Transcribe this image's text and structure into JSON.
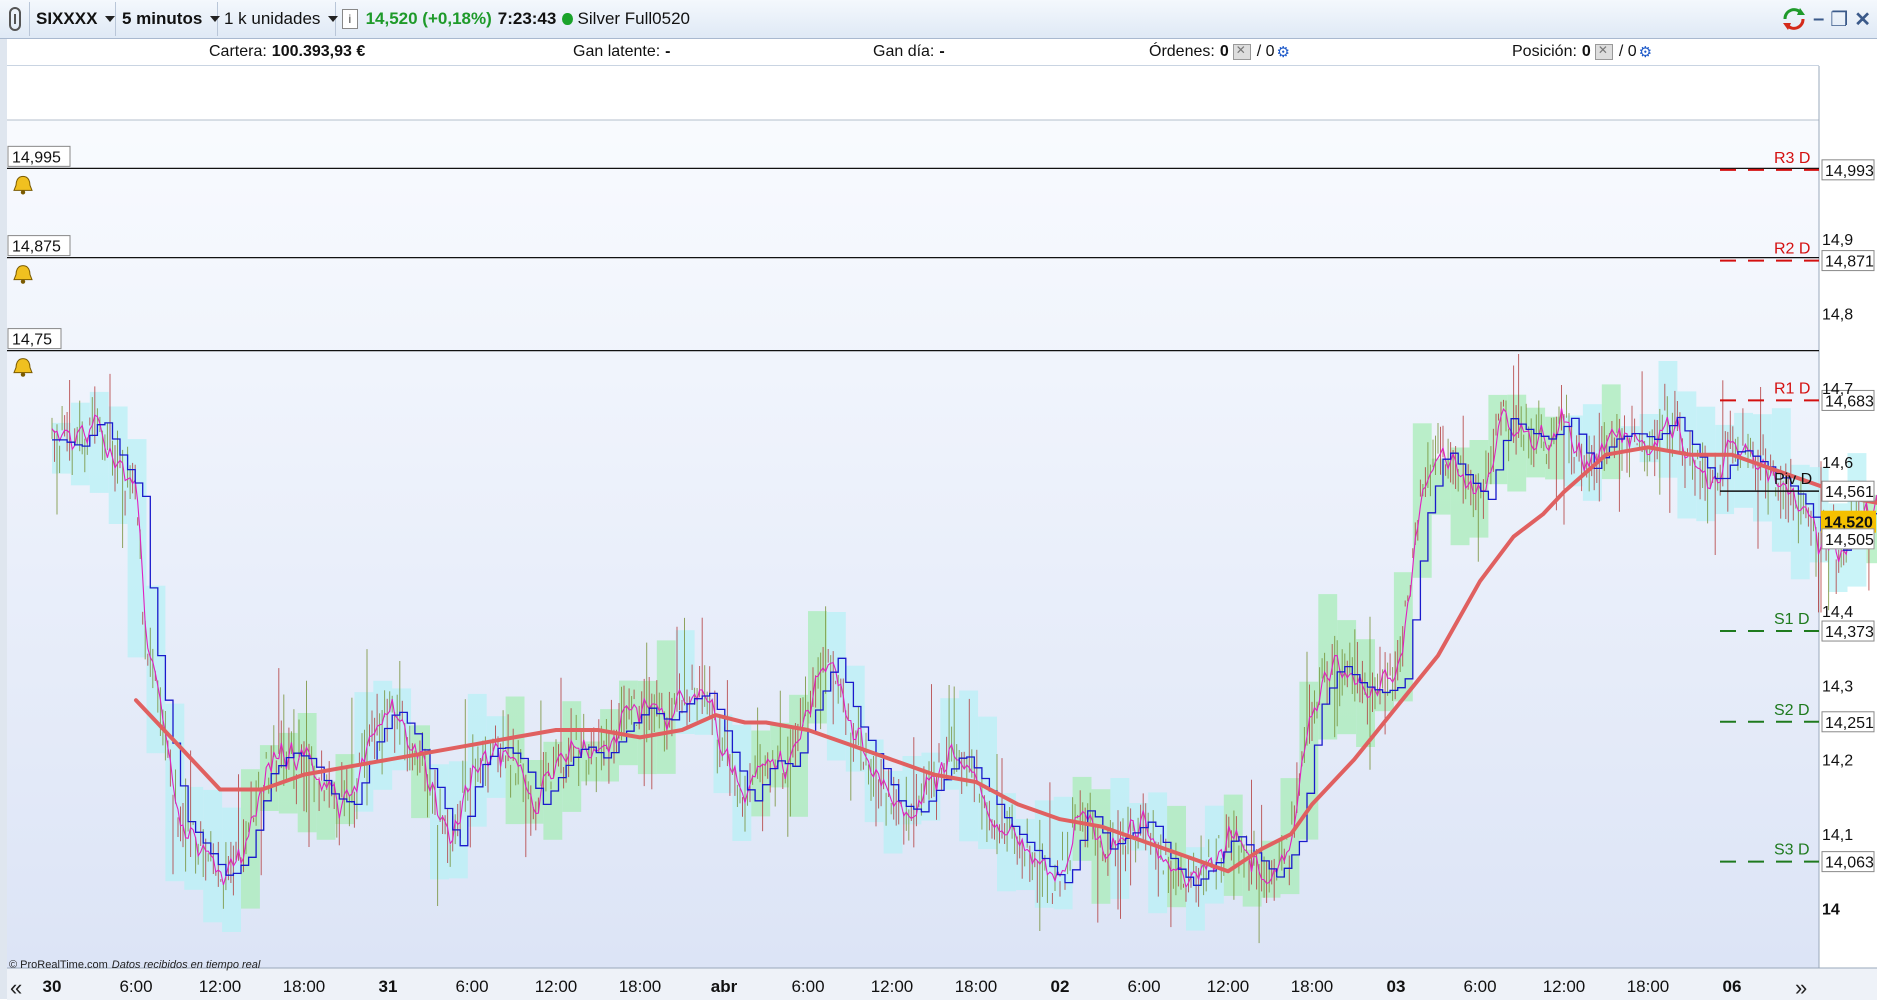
{
  "toolbar": {
    "instrument": "SIXXXX",
    "timeframe": "5 minutos",
    "quantity": "1 k unidades",
    "info_icon": "info-icon",
    "price_change": "14,520 (+0,18%)",
    "time": "7:23:43",
    "status_color": "#1aa32a",
    "contract": "Silver Full0520"
  },
  "account": {
    "portfolio_label": "Cartera:",
    "portfolio_value": "100.393,93 €",
    "latent_label": "Gan latente:",
    "latent_value": "-",
    "day_label": "Gan día:",
    "day_value": "-",
    "orders_label": "Órdenes:",
    "orders_value": "0",
    "orders_value2": "/ 0",
    "position_label": "Posición:",
    "position_value": "0",
    "position_value2": "/ 0"
  },
  "footer": {
    "copyright": "© ProRealTime.com",
    "realtime": "Datos recibidos en tiempo real"
  },
  "colors": {
    "ma": "#e06060",
    "price_fast": "#1a1acc",
    "price_magenta": "#e020c0",
    "bars": "#6f8a2a",
    "cloud_green": "#a8ecb8",
    "cloud_cyan": "#b8f0f6",
    "resistance": "#d41010",
    "support": "#1e7a1e",
    "current_price_bg": "#f5c000"
  },
  "chart_data": {
    "type": "line",
    "title": "",
    "ylim": [
      13.92,
      15.06
    ],
    "x_ticks": [
      "30",
      "6:00",
      "12:00",
      "18:00",
      "31",
      "6:00",
      "12:00",
      "18:00",
      "abr",
      "6:00",
      "12:00",
      "18:00",
      "02",
      "6:00",
      "12:00",
      "18:00",
      "03",
      "6:00",
      "12:00",
      "18:00",
      "06"
    ],
    "x_ticks_bold": [
      true,
      false,
      false,
      false,
      true,
      false,
      false,
      false,
      true,
      false,
      false,
      false,
      true,
      false,
      false,
      false,
      true,
      false,
      false,
      false,
      true
    ],
    "y_ticks": [
      {
        "value": 14.9,
        "label": "14,9"
      },
      {
        "value": 14.8,
        "label": "14,8"
      },
      {
        "value": 14.7,
        "label": "14,7"
      },
      {
        "value": 14.6,
        "label": "14,6"
      },
      {
        "value": 14.4,
        "label": "14,4"
      },
      {
        "value": 14.3,
        "label": "14,3"
      },
      {
        "value": 14.2,
        "label": "14,2"
      },
      {
        "value": 14.1,
        "label": "14,1"
      },
      {
        "value": 14.0,
        "label": "14"
      }
    ],
    "alert_lines": [
      {
        "value": 14.995,
        "label": "14,995"
      },
      {
        "value": 14.875,
        "label": "14,875"
      },
      {
        "value": 14.75,
        "label": "14,75"
      }
    ],
    "pivots": [
      {
        "name": "R3 D",
        "value": 14.993,
        "label": "14,993",
        "kind": "resistance"
      },
      {
        "name": "R2 D",
        "value": 14.871,
        "label": "14,871",
        "kind": "resistance"
      },
      {
        "name": "R1 D",
        "value": 14.683,
        "label": "14,683",
        "kind": "resistance"
      },
      {
        "name": "Piv D",
        "value": 14.561,
        "label": "14,561",
        "kind": "pivot"
      },
      {
        "name": "S1 D",
        "value": 14.373,
        "label": "14,373",
        "kind": "support"
      },
      {
        "name": "S2 D",
        "value": 14.251,
        "label": "14,251",
        "kind": "support"
      },
      {
        "name": "S3 D",
        "value": 14.063,
        "label": "14,063",
        "kind": "support"
      }
    ],
    "current_price": {
      "value": 14.52,
      "label": "14,520"
    },
    "secondary_price": {
      "value": 14.505,
      "label": "14,505"
    },
    "price_series": [
      [
        0,
        14.63
      ],
      [
        0.5,
        14.62
      ],
      [
        1.0,
        14.66
      ],
      [
        1.5,
        14.6
      ],
      [
        2.0,
        14.55
      ],
      [
        2.2,
        14.38
      ],
      [
        2.5,
        14.28
      ],
      [
        3.0,
        14.12
      ],
      [
        3.5,
        14.08
      ],
      [
        4.0,
        14.04
      ],
      [
        4.5,
        14.07
      ],
      [
        5.0,
        14.18
      ],
      [
        5.5,
        14.21
      ],
      [
        6.0,
        14.2
      ],
      [
        6.5,
        14.15
      ],
      [
        7.0,
        14.14
      ],
      [
        7.5,
        14.22
      ],
      [
        8.0,
        14.27
      ],
      [
        8.5,
        14.23
      ],
      [
        9.0,
        14.16
      ],
      [
        9.5,
        14.08
      ],
      [
        10.0,
        14.19
      ],
      [
        10.5,
        14.22
      ],
      [
        11.0,
        14.2
      ],
      [
        11.5,
        14.14
      ],
      [
        12.0,
        14.19
      ],
      [
        12.5,
        14.22
      ],
      [
        13.0,
        14.2
      ],
      [
        13.5,
        14.24
      ],
      [
        14.0,
        14.27
      ],
      [
        14.5,
        14.25
      ],
      [
        15.0,
        14.28
      ],
      [
        15.5,
        14.29
      ],
      [
        16.0,
        14.21
      ],
      [
        16.5,
        14.14
      ],
      [
        17.0,
        14.2
      ],
      [
        17.5,
        14.19
      ],
      [
        18.0,
        14.27
      ],
      [
        18.5,
        14.34
      ],
      [
        19.0,
        14.25
      ],
      [
        19.5,
        14.2
      ],
      [
        20.0,
        14.14
      ],
      [
        20.5,
        14.13
      ],
      [
        21.0,
        14.17
      ],
      [
        21.5,
        14.21
      ],
      [
        22.0,
        14.17
      ],
      [
        22.5,
        14.12
      ],
      [
        23.0,
        14.09
      ],
      [
        23.5,
        14.06
      ],
      [
        24.0,
        14.03
      ],
      [
        24.5,
        14.14
      ],
      [
        25.0,
        14.08
      ],
      [
        25.5,
        14.1
      ],
      [
        26.0,
        14.12
      ],
      [
        26.5,
        14.06
      ],
      [
        27.0,
        14.03
      ],
      [
        27.5,
        14.06
      ],
      [
        28.0,
        14.1
      ],
      [
        28.5,
        14.07
      ],
      [
        29.0,
        14.04
      ],
      [
        29.5,
        14.09
      ],
      [
        30.0,
        14.27
      ],
      [
        30.5,
        14.33
      ],
      [
        31.0,
        14.3
      ],
      [
        31.5,
        14.29
      ],
      [
        32.0,
        14.3
      ],
      [
        32.5,
        14.52
      ],
      [
        33.0,
        14.62
      ],
      [
        33.5,
        14.58
      ],
      [
        34.0,
        14.55
      ],
      [
        34.5,
        14.66
      ],
      [
        35.0,
        14.64
      ],
      [
        35.5,
        14.63
      ],
      [
        36.0,
        14.66
      ],
      [
        36.5,
        14.59
      ],
      [
        37.0,
        14.63
      ],
      [
        37.5,
        14.64
      ],
      [
        38.0,
        14.63
      ],
      [
        38.5,
        14.66
      ],
      [
        39.0,
        14.61
      ],
      [
        39.5,
        14.57
      ],
      [
        40.0,
        14.62
      ],
      [
        40.5,
        14.6
      ],
      [
        41.0,
        14.58
      ],
      [
        41.5,
        14.55
      ],
      [
        42.0,
        14.5
      ],
      [
        42.5,
        14.48
      ],
      [
        43.0,
        14.52
      ],
      [
        43.5,
        14.55
      ],
      [
        44.0,
        14.52
      ],
      [
        44.5,
        14.55
      ],
      [
        45.0,
        14.53
      ]
    ],
    "ma_series": [
      [
        2.0,
        14.28
      ],
      [
        3.0,
        14.22
      ],
      [
        4.0,
        14.16
      ],
      [
        5.0,
        14.16
      ],
      [
        6.0,
        14.18
      ],
      [
        7.0,
        14.19
      ],
      [
        8.0,
        14.2
      ],
      [
        9.0,
        14.21
      ],
      [
        10.0,
        14.22
      ],
      [
        11.0,
        14.23
      ],
      [
        12.0,
        14.24
      ],
      [
        13.0,
        14.24
      ],
      [
        14.0,
        14.23
      ],
      [
        15.0,
        14.24
      ],
      [
        15.8,
        14.26
      ],
      [
        16.5,
        14.25
      ],
      [
        17.0,
        14.25
      ],
      [
        18.0,
        14.24
      ],
      [
        19.0,
        14.22
      ],
      [
        20.0,
        14.2
      ],
      [
        21.0,
        14.18
      ],
      [
        22.0,
        14.17
      ],
      [
        23.0,
        14.14
      ],
      [
        24.0,
        14.12
      ],
      [
        25.0,
        14.11
      ],
      [
        26.0,
        14.09
      ],
      [
        27.0,
        14.07
      ],
      [
        28.0,
        14.05
      ],
      [
        28.8,
        14.08
      ],
      [
        29.5,
        14.1
      ],
      [
        30.0,
        14.14
      ],
      [
        31.0,
        14.2
      ],
      [
        32.0,
        14.27
      ],
      [
        33.0,
        14.34
      ],
      [
        34.0,
        14.44
      ],
      [
        34.8,
        14.5
      ],
      [
        35.5,
        14.53
      ],
      [
        36.0,
        14.56
      ],
      [
        37.0,
        14.61
      ],
      [
        38.0,
        14.62
      ],
      [
        39.0,
        14.61
      ],
      [
        40.0,
        14.61
      ],
      [
        41.0,
        14.59
      ],
      [
        42.0,
        14.57
      ],
      [
        43.0,
        14.55
      ],
      [
        44.0,
        14.54
      ],
      [
        45.0,
        14.52
      ]
    ]
  }
}
